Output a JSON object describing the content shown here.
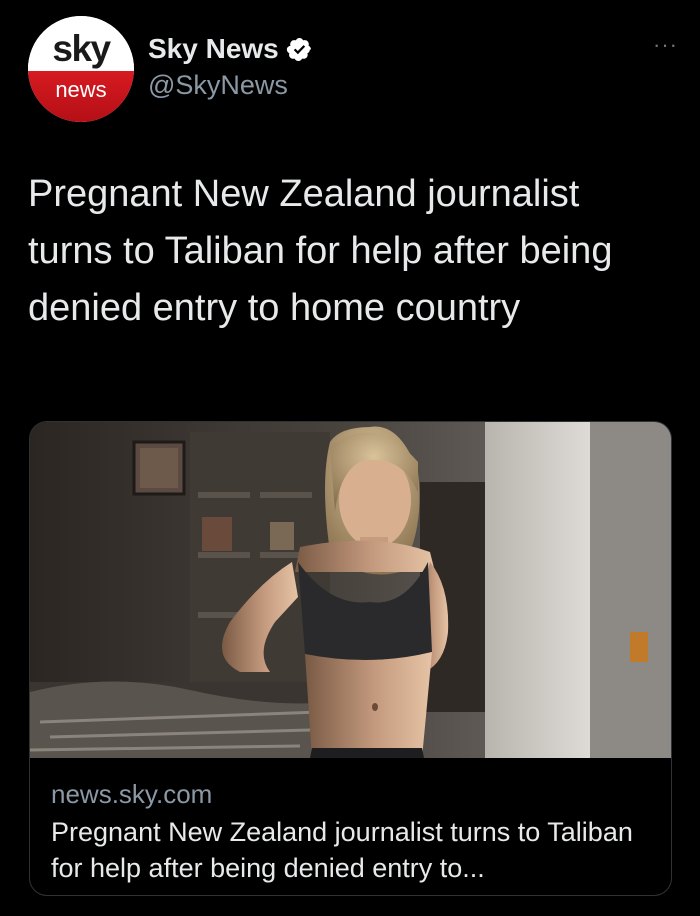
{
  "account": {
    "avatar_brand_top": "sky",
    "avatar_brand_bottom": "news",
    "display_name": "Sky News",
    "handle": "@SkyNews",
    "verified": true,
    "verified_icon": "verified-badge-icon"
  },
  "menu": {
    "more_label": "···",
    "icon": "more-options-icon"
  },
  "tweet": {
    "text": "Pregnant New Zealand journalist turns to Taliban for help after being denied entry to home country"
  },
  "link_card": {
    "image": "photo-pregnant-woman-in-room",
    "domain": "news.sky.com",
    "title": "Pregnant New Zealand journalist turns to Taliban for help after being denied entry to..."
  },
  "colors": {
    "background": "#000000",
    "text_primary": "#e7e9ea",
    "text_secondary": "#8b98a5",
    "card_border": "#2f3336",
    "verified_blue": "#ffffff",
    "sky_red": "#d71a21"
  }
}
